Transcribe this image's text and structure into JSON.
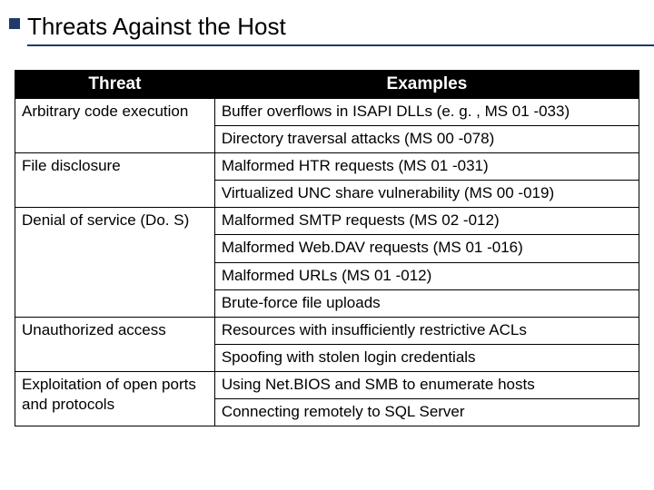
{
  "title": "Threats Against the Host",
  "headers": {
    "col1": "Threat",
    "col2": "Examples"
  },
  "rows": [
    {
      "threat": "Arbitrary code execution",
      "example": "Buffer overflows in ISAPI DLLs (e. g. , MS 01 -033)",
      "threat_rowspan": 2
    },
    {
      "threat": "",
      "example": "Directory traversal attacks (MS 00 -078)"
    },
    {
      "threat": "File disclosure",
      "example": "Malformed HTR requests (MS 01 -031)",
      "threat_rowspan": 2
    },
    {
      "threat": "",
      "example": "Virtualized UNC share vulnerability (MS 00 -019)"
    },
    {
      "threat": "Denial of service (Do. S)",
      "example": "Malformed SMTP requests (MS 02 -012)",
      "threat_rowspan": 4
    },
    {
      "threat": "",
      "example": "Malformed Web.DAV requests (MS 01 -016)"
    },
    {
      "threat": "",
      "example": "Malformed URLs (MS 01 -012)"
    },
    {
      "threat": "",
      "example": "Brute-force file uploads"
    },
    {
      "threat": "Unauthorized access",
      "example": "Resources with insufficiently restrictive ACLs",
      "threat_rowspan": 2
    },
    {
      "threat": "",
      "example": "Spoofing with stolen login credentials"
    },
    {
      "threat": "Exploitation of open ports and protocols",
      "example": "Using Net.BIOS and SMB to enumerate hosts",
      "threat_rowspan": 2
    },
    {
      "threat": "",
      "example": "Connecting remotely to SQL Server"
    }
  ]
}
